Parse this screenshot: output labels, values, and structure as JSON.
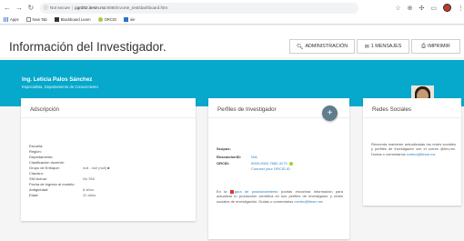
{
  "browser": {
    "url_prefix": "Not secure",
    "url_host": "pgrd02.itesm.mx",
    "url_path": ":8080/cvcete_test/dashboard.htm",
    "bookmarks": [
      "Apps",
      "New Tab",
      "Blackboard Learn",
      "ORCID",
      "sie"
    ]
  },
  "header": {
    "title": "Información del Investigador.",
    "admin_label": "ADMINISTRACIÓN",
    "messages_label": "1 MENSAJES",
    "print_label": "IMPRIMIR"
  },
  "profile": {
    "name": "Ing. Leticia Palos Sánchez",
    "subtitle": "Especialista, Departamento de Conocimiento"
  },
  "adscripcion": {
    "title": "Adscripción",
    "rows": [
      {
        "label": "Escuela:",
        "value": ""
      },
      {
        "label": "Región:",
        "value": ""
      },
      {
        "label": "Departamento:",
        "value": ""
      },
      {
        "label": "Clasificación docente:",
        "value": ""
      },
      {
        "label": "Grupo de Enfoque:",
        "value": "null - null (null) ■"
      },
      {
        "label": "Claustro:",
        "value": ""
      },
      {
        "label": "SNI Actual:",
        "value": "No SNI"
      },
      {
        "label": "Fecha de ingreso al modelo:",
        "value": ""
      },
      {
        "label": "Antigüedad:",
        "value": "8 años"
      },
      {
        "label": "Edad:",
        "value": "31 años"
      }
    ]
  },
  "perfiles": {
    "title": "Perfiles de Investigador",
    "add_label": "+",
    "scopus_label": "Scopus:",
    "researcher_label": "ResearcherID:",
    "researcher_value": "N/A",
    "orcid_label": "ORCID:",
    "orcid_value": "0000-0002-7682-4173",
    "orcid_connect": "Connect your ORCID iD",
    "text_pre": "En la",
    "text_link": "guía de posicionamiento",
    "text_post": "podrás encontrar información para actualizar tu producción científica en sus perfiles de investigador y redes sociales de investigación. Dudas o comentarios",
    "text_email": "cvetec@itesm.mx"
  },
  "redes": {
    "title": "Redes Sociales",
    "text": "Recuerda mantener actualizadas tus redes sociales y perfiles de investigador con el correo @tec.mx. Dudas o comentarios",
    "email": "cvetec@itesm.mx"
  }
}
